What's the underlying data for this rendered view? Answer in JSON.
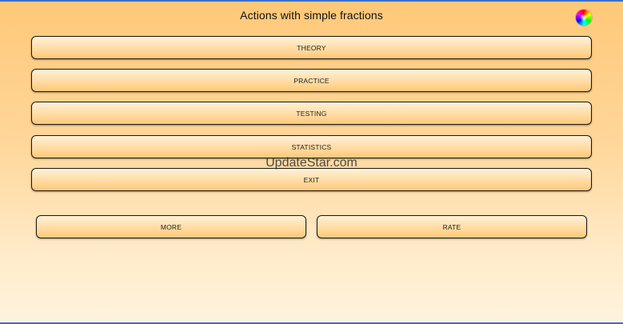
{
  "header": {
    "title": "Actions with simple fractions",
    "theme_icon": "color-wheel-icon"
  },
  "menu": {
    "theory": "THEORY",
    "practice": "PRACTICE",
    "testing": "TESTING",
    "statistics": "STATISTICS",
    "exit": "EXIT"
  },
  "footer_buttons": {
    "more": "MORE",
    "rate": "RATE"
  },
  "watermark": "UpdateStar.com",
  "colors": {
    "background_top": "#ffc878",
    "background_bottom": "#fff3de",
    "button_border": "#1a1a1a",
    "frame_accent": "#3a6fd0"
  }
}
